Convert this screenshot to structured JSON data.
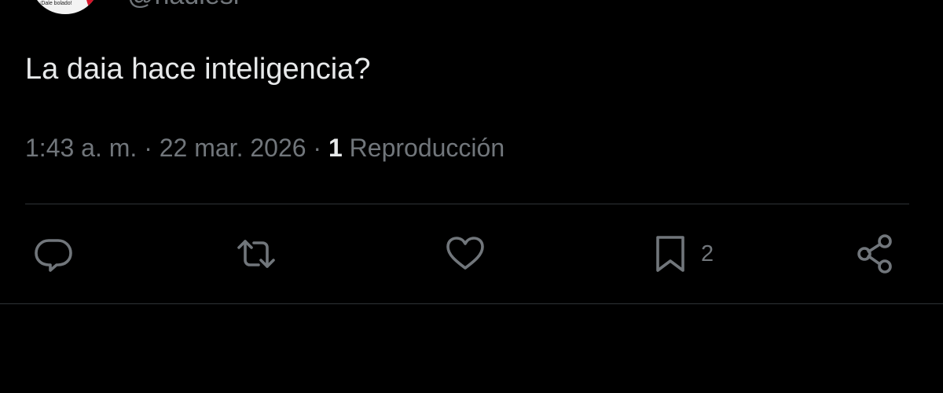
{
  "author": {
    "handle": "@nadiesr",
    "avatar_text": "¡Dale bolado!"
  },
  "tweet": {
    "text": "La daia hace inteligencia?",
    "time": "1:43 a. m.",
    "separator": "·",
    "date": "22 mar. 2026",
    "views_count": "1",
    "views_label": "Reproducción"
  },
  "actions": {
    "reply": {
      "icon": "reply-icon"
    },
    "repost": {
      "icon": "repost-icon"
    },
    "like": {
      "icon": "heart-icon"
    },
    "bookmark": {
      "icon": "bookmark-icon",
      "count": "2"
    },
    "share": {
      "icon": "share-icon"
    }
  },
  "colors": {
    "background": "#000000",
    "text_primary": "#e7e9ea",
    "text_secondary": "#71767b",
    "divider": "#2f3336"
  }
}
